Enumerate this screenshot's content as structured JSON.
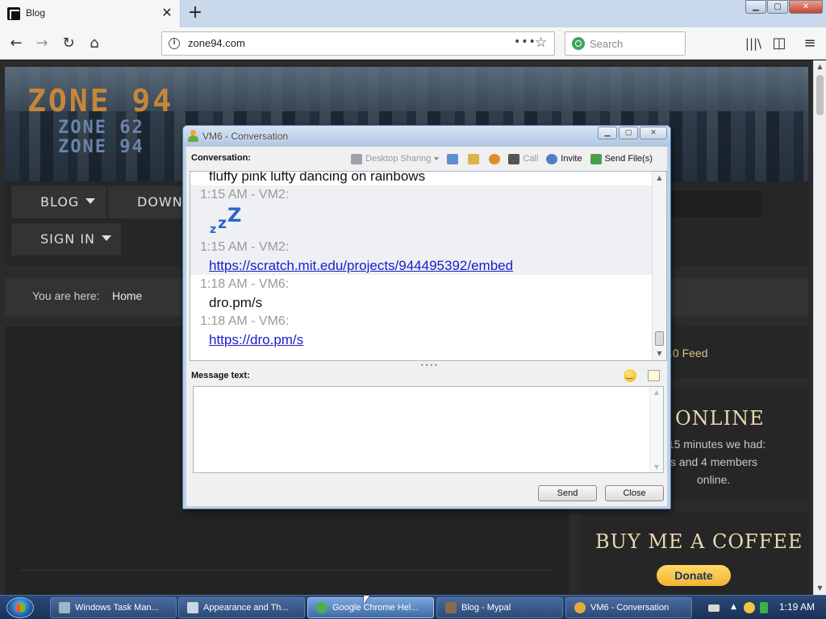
{
  "browser": {
    "tab_title": "Blog",
    "url": "zone94.com",
    "search_placeholder": "Search"
  },
  "site": {
    "logo_main": "ZONE 94",
    "logo_sub_1": "ZONE 62",
    "logo_sub_2": "ZONE 94",
    "menu": {
      "blog": "BLOG",
      "downloads": "DOWNL",
      "sign_in": "SIGN IN"
    },
    "breadcrumb": {
      "label": "You are here:",
      "home": "Home"
    },
    "feed": ".0 Feed",
    "online_title": "ONLINE",
    "online_lines": [
      "t 15 minutes we had:",
      "sts and 4 members",
      "online."
    ],
    "coffee_title": "BUY ME A COFFEE",
    "donate_label": "Donate"
  },
  "conversation": {
    "title": "VM6 - Conversation",
    "conversation_label": "Conversation:",
    "tools": {
      "desktop_sharing": "Desktop Sharing",
      "call": "Call",
      "invite": "Invite",
      "send_files": "Send File(s)"
    },
    "messages": [
      {
        "text": "fluffy pink lufty dancing on rainbows"
      },
      {
        "header": "1:15 AM - VM2:",
        "sticker": "zzz-sticker"
      },
      {
        "header": "1:15 AM - VM2:",
        "link": "https://scratch.mit.edu/projects/944495392/embed"
      },
      {
        "header": "1:18 AM - VM6:",
        "text": "dro.pm/s"
      },
      {
        "header": "1:18 AM - VM6:",
        "link": "https://dro.pm/s"
      }
    ],
    "message_label": "Message text:",
    "message_value": "",
    "send_label": "Send",
    "close_label": "Close"
  },
  "taskbar": {
    "items": [
      {
        "label": "Windows Task Man...",
        "icon": "task-manager-icon"
      },
      {
        "label": "Appearance and Th...",
        "icon": "control-panel-icon"
      },
      {
        "label": "Google Chrome Hel...",
        "icon": "chrome-icon"
      },
      {
        "label": "Blog - Mypal",
        "icon": "mypal-icon"
      },
      {
        "label": "VM6 - Conversation",
        "icon": "messenger-icon"
      }
    ],
    "clock": "1:19 AM"
  }
}
